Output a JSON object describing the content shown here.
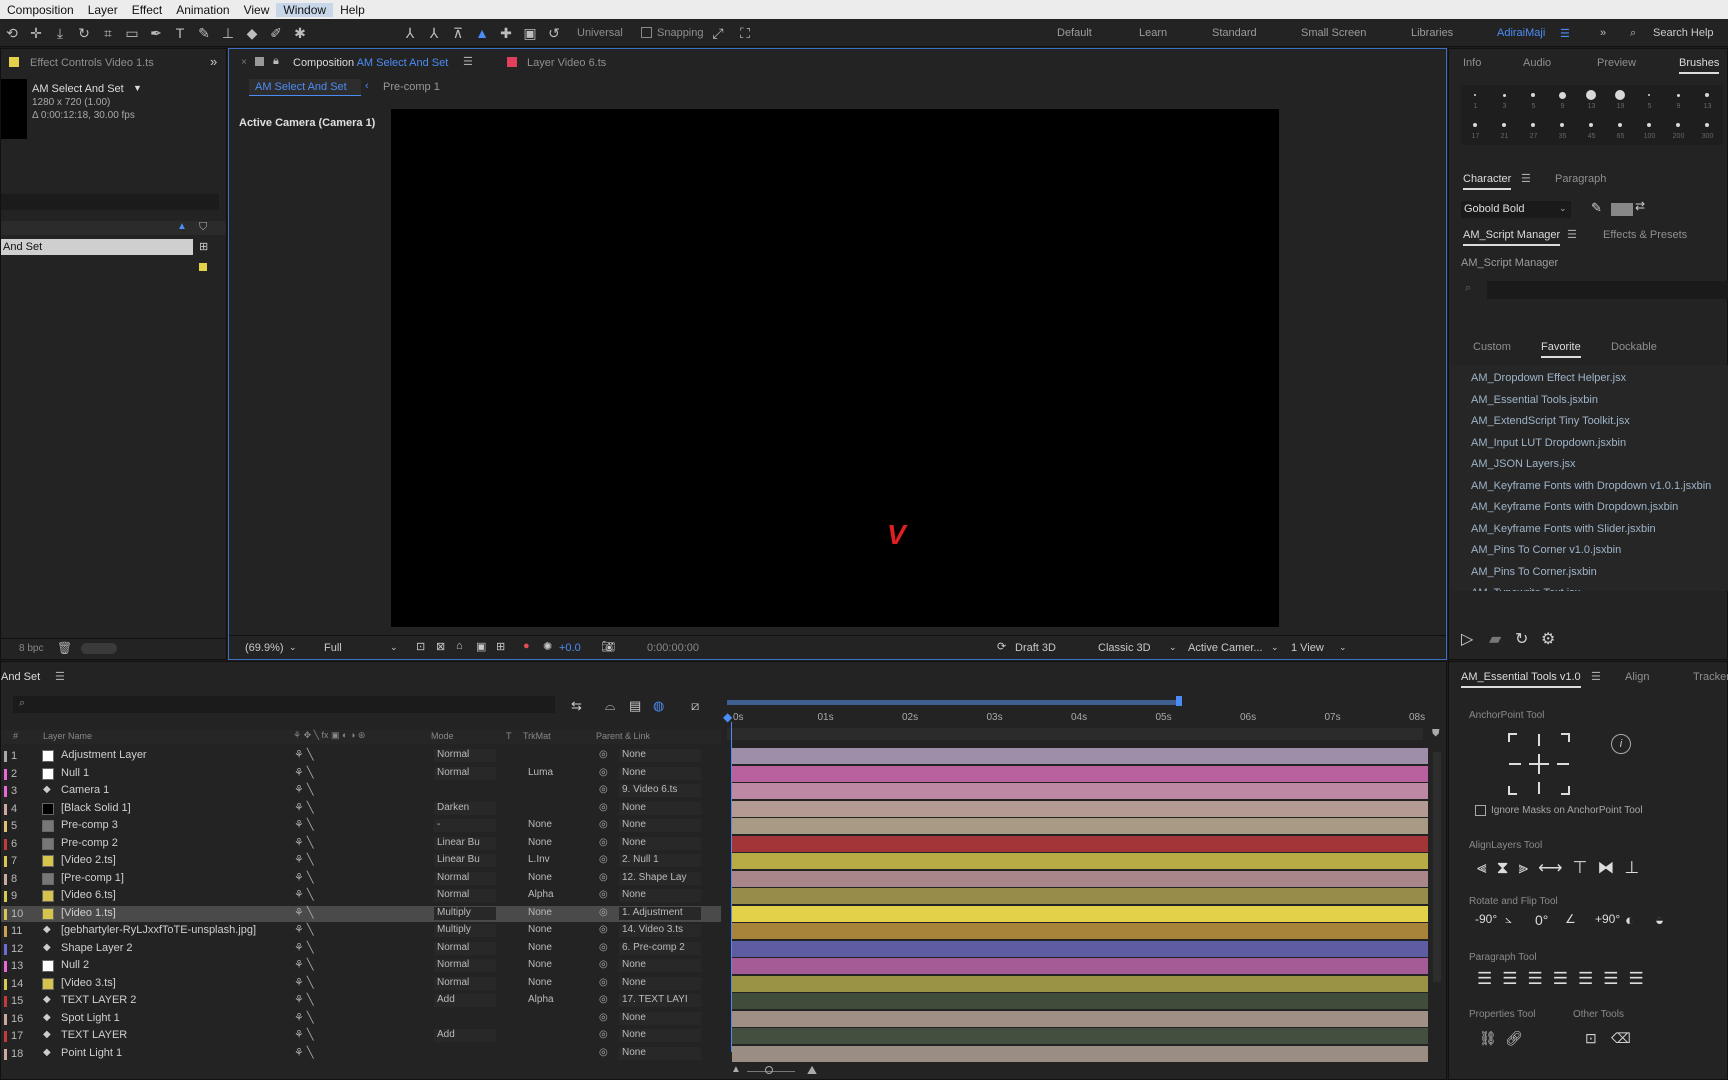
{
  "menu": [
    "Composition",
    "Layer",
    "Effect",
    "Animation",
    "View",
    "Window",
    "Help"
  ],
  "menu_active": "Window",
  "toolbar": {
    "universal_label": "Universal",
    "snapping_label": "Snapping",
    "workspaces": [
      "Default",
      "Learn",
      "Standard",
      "Small Screen",
      "Libraries",
      "AdiraiMaji"
    ],
    "active_workspace": "AdiraiMaji",
    "search_placeholder": "Search Help"
  },
  "effect_controls": {
    "tab_label": "Effect Controls Video 1.ts",
    "comp_name": "AM Select And Set",
    "comp_size": "1280 x 720 (1.00)",
    "comp_duration": "Δ 0:00:12:18, 30.00 fps",
    "project_item": "And Set",
    "bpc": "8 bpc"
  },
  "composition": {
    "tab_label_prefix": "Composition",
    "tab_label_name": "AM Select And Set",
    "layer_tab": "Layer  Video 6.ts",
    "breadcrumb_current": "AM Select And Set",
    "breadcrumb_next": "Pre-comp 1",
    "active_camera_label": "Active Camera (Camera 1)",
    "viewer_glyph": "V",
    "footer": {
      "zoom": "(69.9%)",
      "resolution": "Full",
      "exposure": "+0.0",
      "timecode": "0:00:00:00",
      "draft3d": "Draft 3D",
      "renderer": "Classic 3D",
      "camera": "Active Camer...",
      "views": "1 View"
    }
  },
  "right_top": {
    "tabs": [
      "Info",
      "Audio",
      "Preview",
      "Brushes"
    ],
    "active_tab": "Brushes",
    "brush_sizes": [
      "1",
      "3",
      "5",
      "9",
      "13",
      "19",
      "5",
      "9",
      "13",
      "17",
      "21",
      "27",
      "35",
      "45",
      "65",
      "100",
      "200",
      "300"
    ],
    "character_tabs": [
      "Character",
      "Paragraph"
    ],
    "font": "Gobold Bold",
    "script_tabs": [
      "AM_Script Manager",
      "Effects & Presets"
    ],
    "script_manager_title": "AM_Script Manager",
    "subtabs": [
      "Custom",
      "Favorite",
      "Dockable"
    ],
    "active_subtab": "Favorite",
    "scripts": [
      "AM_Dropdown Effect Helper.jsx",
      "AM_Essential Tools.jsxbin",
      "AM_ExtendScript Tiny Toolkit.jsx",
      "AM_Input LUT Dropdown.jsxbin",
      "AM_JSON Layers.jsx",
      "AM_Keyframe Fonts with Dropdown v1.0.1.jsxbin",
      "AM_Keyframe Fonts with Dropdown.jsxbin",
      "AM_Keyframe Fonts with Slider.jsxbin",
      "AM_Pins To Corner v1.0.jsxbin",
      "AM_Pins To Corner.jsxbin",
      "AM_Typewrite Text.jsx"
    ]
  },
  "essential_tools": {
    "tabs": [
      "AM_Essential Tools v1.0",
      "Align",
      "Tracker"
    ],
    "anchor_title": "AnchorPoint Tool",
    "ignore_masks": "Ignore Masks on AnchorPoint Tool",
    "align_title": "AlignLayers Tool",
    "rotate_title": "Rotate and Flip Tool",
    "rotate_labels": [
      "-90°",
      "",
      "0°",
      "",
      "+90°"
    ],
    "paragraph_title": "Paragraph Tool",
    "properties_title": "Properties Tool",
    "other_title": "Other Tools"
  },
  "timeline": {
    "tab_label": "And Set",
    "headers": {
      "num": "#",
      "name": "Layer Name",
      "mode": "Mode",
      "t": "T",
      "trkmat": "TrkMat",
      "parent": "Parent & Link"
    },
    "ruler": [
      "0s",
      "01s",
      "02s",
      "03s",
      "04s",
      "05s",
      "06s",
      "07s",
      "08s"
    ],
    "layers": [
      {
        "num": "1",
        "name": "Adjustment Layer",
        "mode": "Normal",
        "trk": "",
        "parent": "None",
        "label": "#a8a8a8",
        "swatch": "#ffffff",
        "bar": "#9e8ea9"
      },
      {
        "num": "2",
        "name": "Null 1",
        "mode": "Normal",
        "trk": "Luma",
        "parent": "None",
        "label": "#e86ad6",
        "swatch": "#ffffff",
        "bar": "#b9619f"
      },
      {
        "num": "3",
        "name": "Camera 1",
        "mode": "",
        "trk": "",
        "parent": "9. Video 6.ts",
        "label": "#e86ad6",
        "swatch": "",
        "bar": "#bd88a4"
      },
      {
        "num": "4",
        "name": "[Black Solid 1]",
        "mode": "Darken",
        "trk": "",
        "parent": "None",
        "label": "#c9a9a0",
        "swatch": "#000000",
        "bar": "#b39a93"
      },
      {
        "num": "5",
        "name": "Pre-comp 3",
        "mode": "-",
        "trk": "None",
        "parent": "None",
        "label": "#e0c270",
        "swatch": "#777777",
        "bar": "#a89a85"
      },
      {
        "num": "6",
        "name": "Pre-comp 2",
        "mode": "Linear Bu",
        "trk": "None",
        "parent": "None",
        "label": "#c23b3b",
        "swatch": "#777777",
        "bar": "#a33539"
      },
      {
        "num": "7",
        "name": "[Video 2.ts]",
        "mode": "Linear Bu",
        "trk": "L.Inv",
        "parent": "2. Null 1",
        "label": "#d8c850",
        "swatch": "#d6c54a",
        "bar": "#b8aa45"
      },
      {
        "num": "8",
        "name": "[Pre-comp 1]",
        "mode": "Normal",
        "trk": "None",
        "parent": "12. Shape Lay",
        "label": "#c9a9a0",
        "swatch": "#777777",
        "bar": "#a8868a"
      },
      {
        "num": "9",
        "name": "[Video 6.ts]",
        "mode": "Normal",
        "trk": "Alpha",
        "parent": "None",
        "label": "#d8c850",
        "swatch": "#d6c54a",
        "bar": "#988c4a"
      },
      {
        "num": "10",
        "name": "[Video 1.ts]",
        "mode": "Multiply",
        "trk": "None",
        "parent": "1. Adjustment",
        "label": "#d8c850",
        "swatch": "#d6c54a",
        "bar": "#e3d14a",
        "selected": true
      },
      {
        "num": "11",
        "name": "[gebhartyler-RyLJxxfToTE-unsplash.jpg]",
        "mode": "Multiply",
        "trk": "None",
        "parent": "14. Video 3.ts",
        "label": "#c9a050",
        "swatch": "",
        "bar": "#a8843a"
      },
      {
        "num": "12",
        "name": "Shape Layer 2",
        "mode": "Normal",
        "trk": "None",
        "parent": "6. Pre-comp 2",
        "label": "#6d6bd6",
        "swatch": "",
        "bar": "#5e5ca3"
      },
      {
        "num": "13",
        "name": "Null 2",
        "mode": "Normal",
        "trk": "None",
        "parent": "None",
        "label": "#e86ad6",
        "swatch": "#ffffff",
        "bar": "#a55b96"
      },
      {
        "num": "14",
        "name": "[Video 3.ts]",
        "mode": "Normal",
        "trk": "None",
        "parent": "None",
        "label": "#d8c850",
        "swatch": "#d6c54a",
        "bar": "#9a9244"
      },
      {
        "num": "15",
        "name": "TEXT LAYER 2",
        "mode": "Add",
        "trk": "Alpha",
        "parent": "17. TEXT LAYI",
        "label": "#c23b3b",
        "swatch": "",
        "bar": "#3f4d3a"
      },
      {
        "num": "16",
        "name": "Spot Light 1",
        "mode": "",
        "trk": "",
        "parent": "None",
        "label": "#c9a9a0",
        "swatch": "",
        "bar": "#a08f85"
      },
      {
        "num": "17",
        "name": "TEXT LAYER",
        "mode": "Add",
        "trk": "",
        "parent": "None",
        "label": "#c23b3b",
        "swatch": "",
        "bar": "#44503f"
      },
      {
        "num": "18",
        "name": "Point Light 1",
        "mode": "",
        "trk": "",
        "parent": "None",
        "label": "#c9a9a0",
        "swatch": "",
        "bar": "#9a8e84"
      }
    ]
  },
  "colors": {
    "accent": "#4c8cf5",
    "panel": "#232323",
    "viewer_bg": "#000000"
  }
}
